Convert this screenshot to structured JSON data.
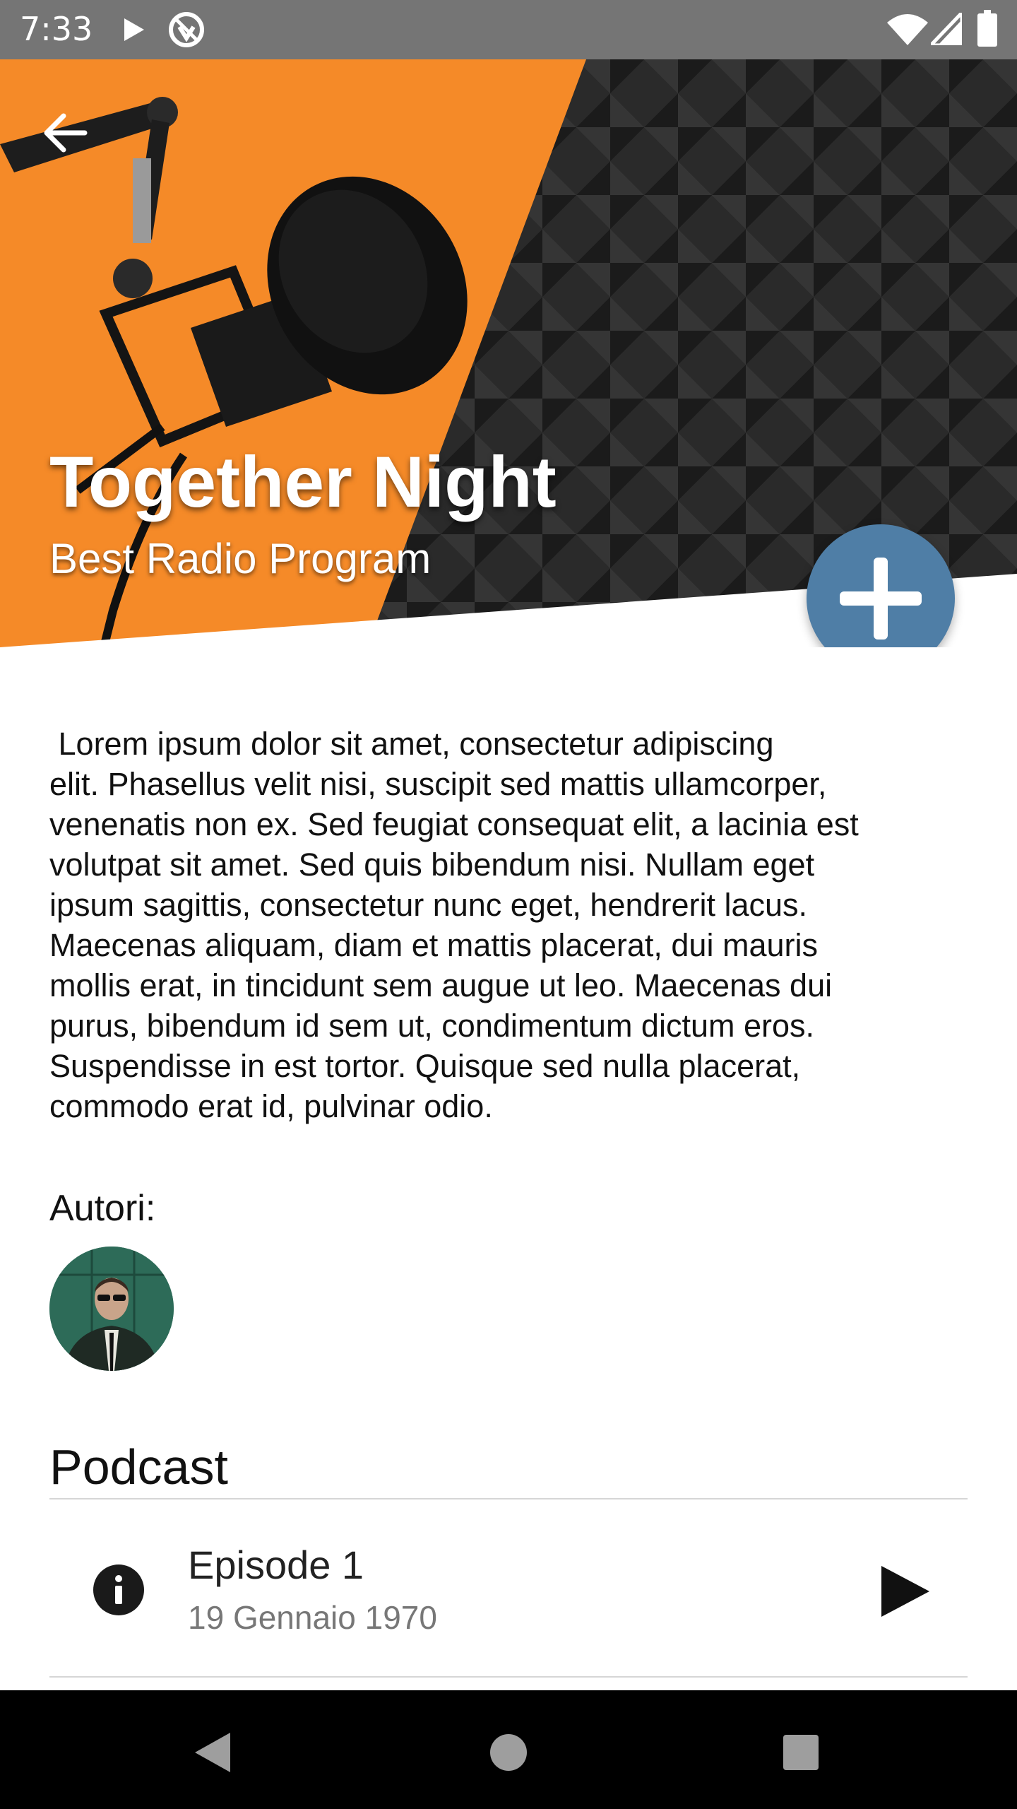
{
  "status_bar": {
    "time": "7:33",
    "icons": [
      "play-icon",
      "vpn-icon",
      "wifi-icon",
      "signal-icon",
      "battery-icon"
    ]
  },
  "header": {
    "title": "Together Night",
    "subtitle": "Best Radio Program",
    "back_icon": "arrow-back-icon",
    "fab_icon": "plus-icon",
    "colors": {
      "accent_orange": "#f58a28",
      "fab_blue": "#4f7ea6"
    }
  },
  "description": " Lorem ipsum dolor sit amet, consectetur adipiscing\nelit. Phasellus velit nisi, suscipit sed mattis ullamcorper,\nvenenatis non ex. Sed feugiat consequat elit, a lacinia est\nvolutpat sit amet. Sed quis bibendum nisi. Nullam eget\nipsum sagittis, consectetur nunc eget, hendrerit lacus.\nMaecenas aliquam, diam et mattis placerat, dui mauris\nmollis erat, in tincidunt sem augue ut leo. Maecenas dui\npurus, bibendum id sem ut, condimentum dictum eros.\nSuspendisse in est tortor. Quisque sed nulla placerat,\ncommodo erat id, pulvinar odio.",
  "authors": {
    "label": "Autori:"
  },
  "podcast": {
    "heading": "Podcast",
    "episodes": [
      {
        "title": "Episode 1",
        "date": "19 Gennaio 1970",
        "info_icon": "info-icon",
        "play_icon": "play-icon"
      }
    ]
  },
  "nav_bar": {
    "icons": [
      "back-triangle-icon",
      "home-circle-icon",
      "recents-square-icon"
    ]
  }
}
